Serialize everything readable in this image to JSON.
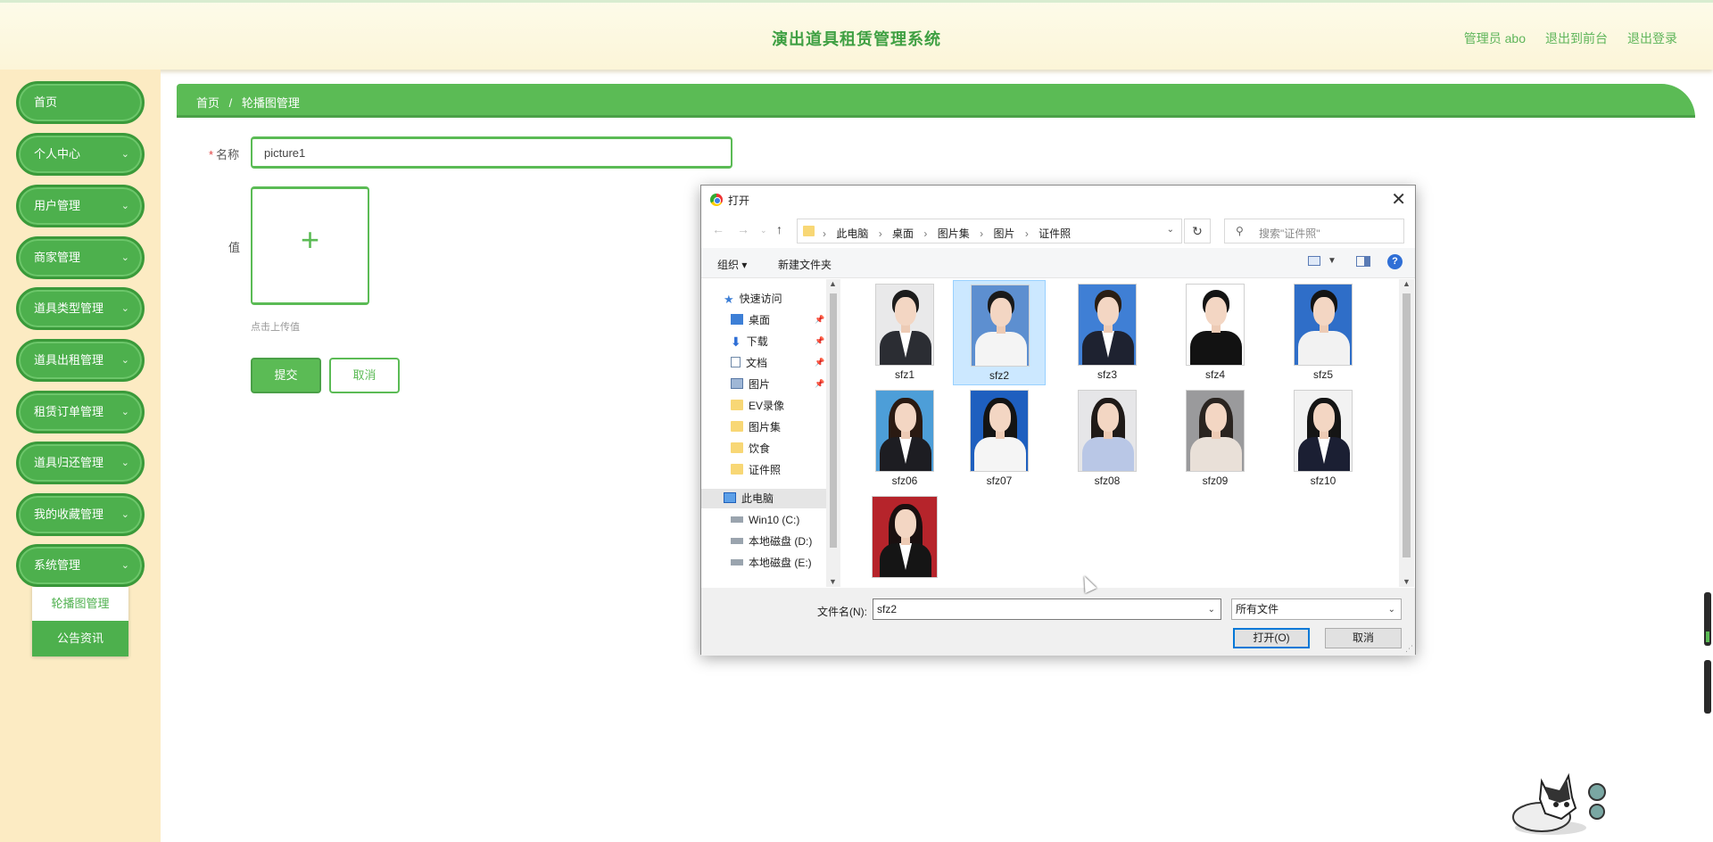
{
  "header": {
    "title": "演出道具租赁管理系统",
    "admin_label": "管理员 abo",
    "front_link": "退出到前台",
    "logout_link": "退出登录"
  },
  "sidebar": {
    "items": [
      {
        "label": "首页",
        "has_children": false
      },
      {
        "label": "个人中心",
        "has_children": true
      },
      {
        "label": "用户管理",
        "has_children": true
      },
      {
        "label": "商家管理",
        "has_children": true
      },
      {
        "label": "道具类型管理",
        "has_children": true
      },
      {
        "label": "道具出租管理",
        "has_children": true
      },
      {
        "label": "租赁订单管理",
        "has_children": true
      },
      {
        "label": "道具归还管理",
        "has_children": true
      },
      {
        "label": "我的收藏管理",
        "has_children": true
      },
      {
        "label": "系统管理",
        "has_children": true
      }
    ],
    "submenu": [
      "轮播图管理",
      "公告资讯"
    ]
  },
  "breadcrumb": {
    "home": "首页",
    "sep": "/",
    "current": "轮播图管理"
  },
  "form": {
    "name_required": "*",
    "name_label": "名称",
    "name_value": "picture1",
    "value_label": "值",
    "upload_plus": "+",
    "upload_hint": "点击上传值",
    "submit_label": "提交",
    "cancel_label": "取消"
  },
  "dialog": {
    "title": "打开",
    "close": "✕",
    "path": [
      "此电脑",
      "桌面",
      "图片集",
      "图片",
      "证件照"
    ],
    "path_sep": "›",
    "search_placeholder": "搜索\"证件照\"",
    "organize": "组织 ▾",
    "new_folder": "新建文件夹",
    "help": "?",
    "nav": {
      "quick_access": "快速访问",
      "desktop": "桌面",
      "downloads": "下载",
      "documents": "文档",
      "pictures": "图片",
      "ev": "EV录像",
      "picset": "图片集",
      "food": "饮食",
      "idphoto": "证件照",
      "this_pc": "此电脑",
      "drive_c": "Win10 (C:)",
      "drive_d": "本地磁盘 (D:)",
      "drive_e": "本地磁盘 (E:)"
    },
    "files": [
      "sfz1",
      "sfz2",
      "sfz3",
      "sfz4",
      "sfz5",
      "sfz06",
      "sfz07",
      "sfz08",
      "sfz09",
      "sfz10",
      ""
    ],
    "selected_file": "sfz2",
    "filename_label": "文件名(N):",
    "filename_value": "sfz2",
    "filetype_value": "所有文件",
    "open_button": "打开(O)",
    "cancel_button": "取消"
  },
  "colors": {
    "accent": "#5bbb55",
    "sidebar_bg": "#fcebc3",
    "header_bg": "#fcf5d8"
  }
}
